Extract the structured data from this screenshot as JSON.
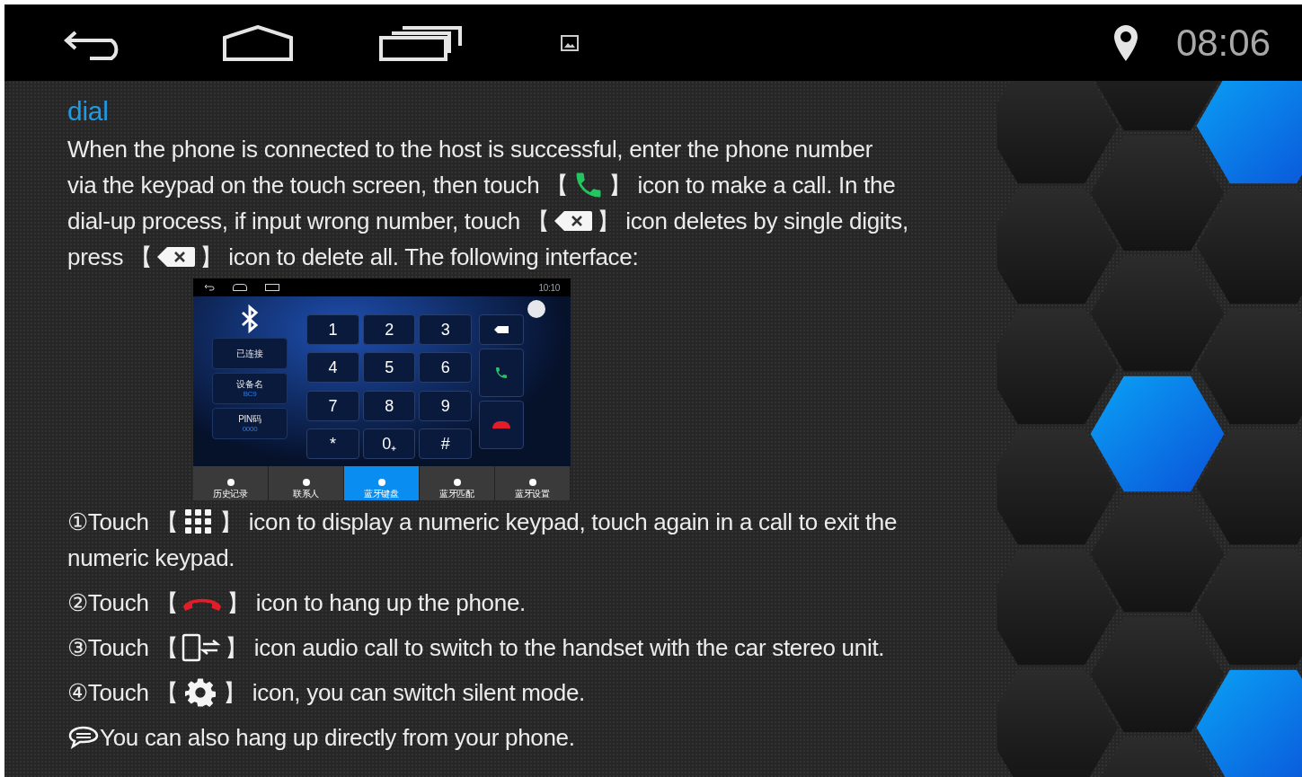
{
  "status_bar": {
    "time": "08:06"
  },
  "heading": "dial",
  "intro_lines": [
    [
      {
        "kind": "text",
        "text": "When the phone is connected to the host is successful, enter the phone number"
      }
    ],
    [
      {
        "kind": "text",
        "text": "via the keypad on the touch screen, then touch 【"
      },
      {
        "kind": "call"
      },
      {
        "kind": "text",
        "text": "】 icon to make a call. In the"
      }
    ],
    [
      {
        "kind": "text",
        "text": "dial-up process, if input wrong number, touch 【"
      },
      {
        "kind": "backspace"
      },
      {
        "kind": "text",
        "text": "】 icon deletes by single digits,"
      }
    ],
    [
      {
        "kind": "text",
        "text": "press 【"
      },
      {
        "kind": "backspace"
      },
      {
        "kind": "text",
        "text": "】 icon to delete all. The following interface:"
      }
    ]
  ],
  "embedded_screen": {
    "time": "10:10",
    "info": [
      {
        "label": "已连接"
      },
      {
        "label": "设备名",
        "value": "BC9"
      },
      {
        "label": "PIN码",
        "value": "0000"
      }
    ],
    "keys": [
      "1",
      "2",
      "3",
      "4",
      "5",
      "6",
      "7",
      "8",
      "9",
      "*",
      "0₊",
      "#"
    ],
    "tabs": [
      {
        "label": "历史记录",
        "selected": false
      },
      {
        "label": "联系人",
        "selected": false
      },
      {
        "label": "蓝牙键盘",
        "selected": true
      },
      {
        "label": "蓝牙匹配",
        "selected": false
      },
      {
        "label": "蓝牙设置",
        "selected": false
      }
    ]
  },
  "steps": [
    [
      {
        "kind": "text",
        "text": "①Touch 【"
      },
      {
        "kind": "keypad"
      },
      {
        "kind": "text",
        "text": "】 icon to display a numeric keypad, touch again in a call to exit the"
      }
    ],
    [
      {
        "kind": "text",
        "text": "numeric keypad."
      }
    ],
    [
      {
        "kind": "text",
        "text": "②Touch 【"
      },
      {
        "kind": "hangup"
      },
      {
        "kind": "text",
        "text": "】 icon to hang up the phone."
      }
    ],
    [
      {
        "kind": "text",
        "text": "③Touch 【"
      },
      {
        "kind": "switch"
      },
      {
        "kind": "text",
        "text": "】 icon audio call to switch to the handset with the car stereo unit."
      }
    ],
    [
      {
        "kind": "text",
        "text": "④Touch 【"
      },
      {
        "kind": "gear"
      },
      {
        "kind": "text",
        "text": "】 icon, you can switch silent mode."
      }
    ],
    [
      {
        "kind": "bubble"
      },
      {
        "kind": "text",
        "text": "You can also hang up directly from your phone."
      }
    ]
  ]
}
